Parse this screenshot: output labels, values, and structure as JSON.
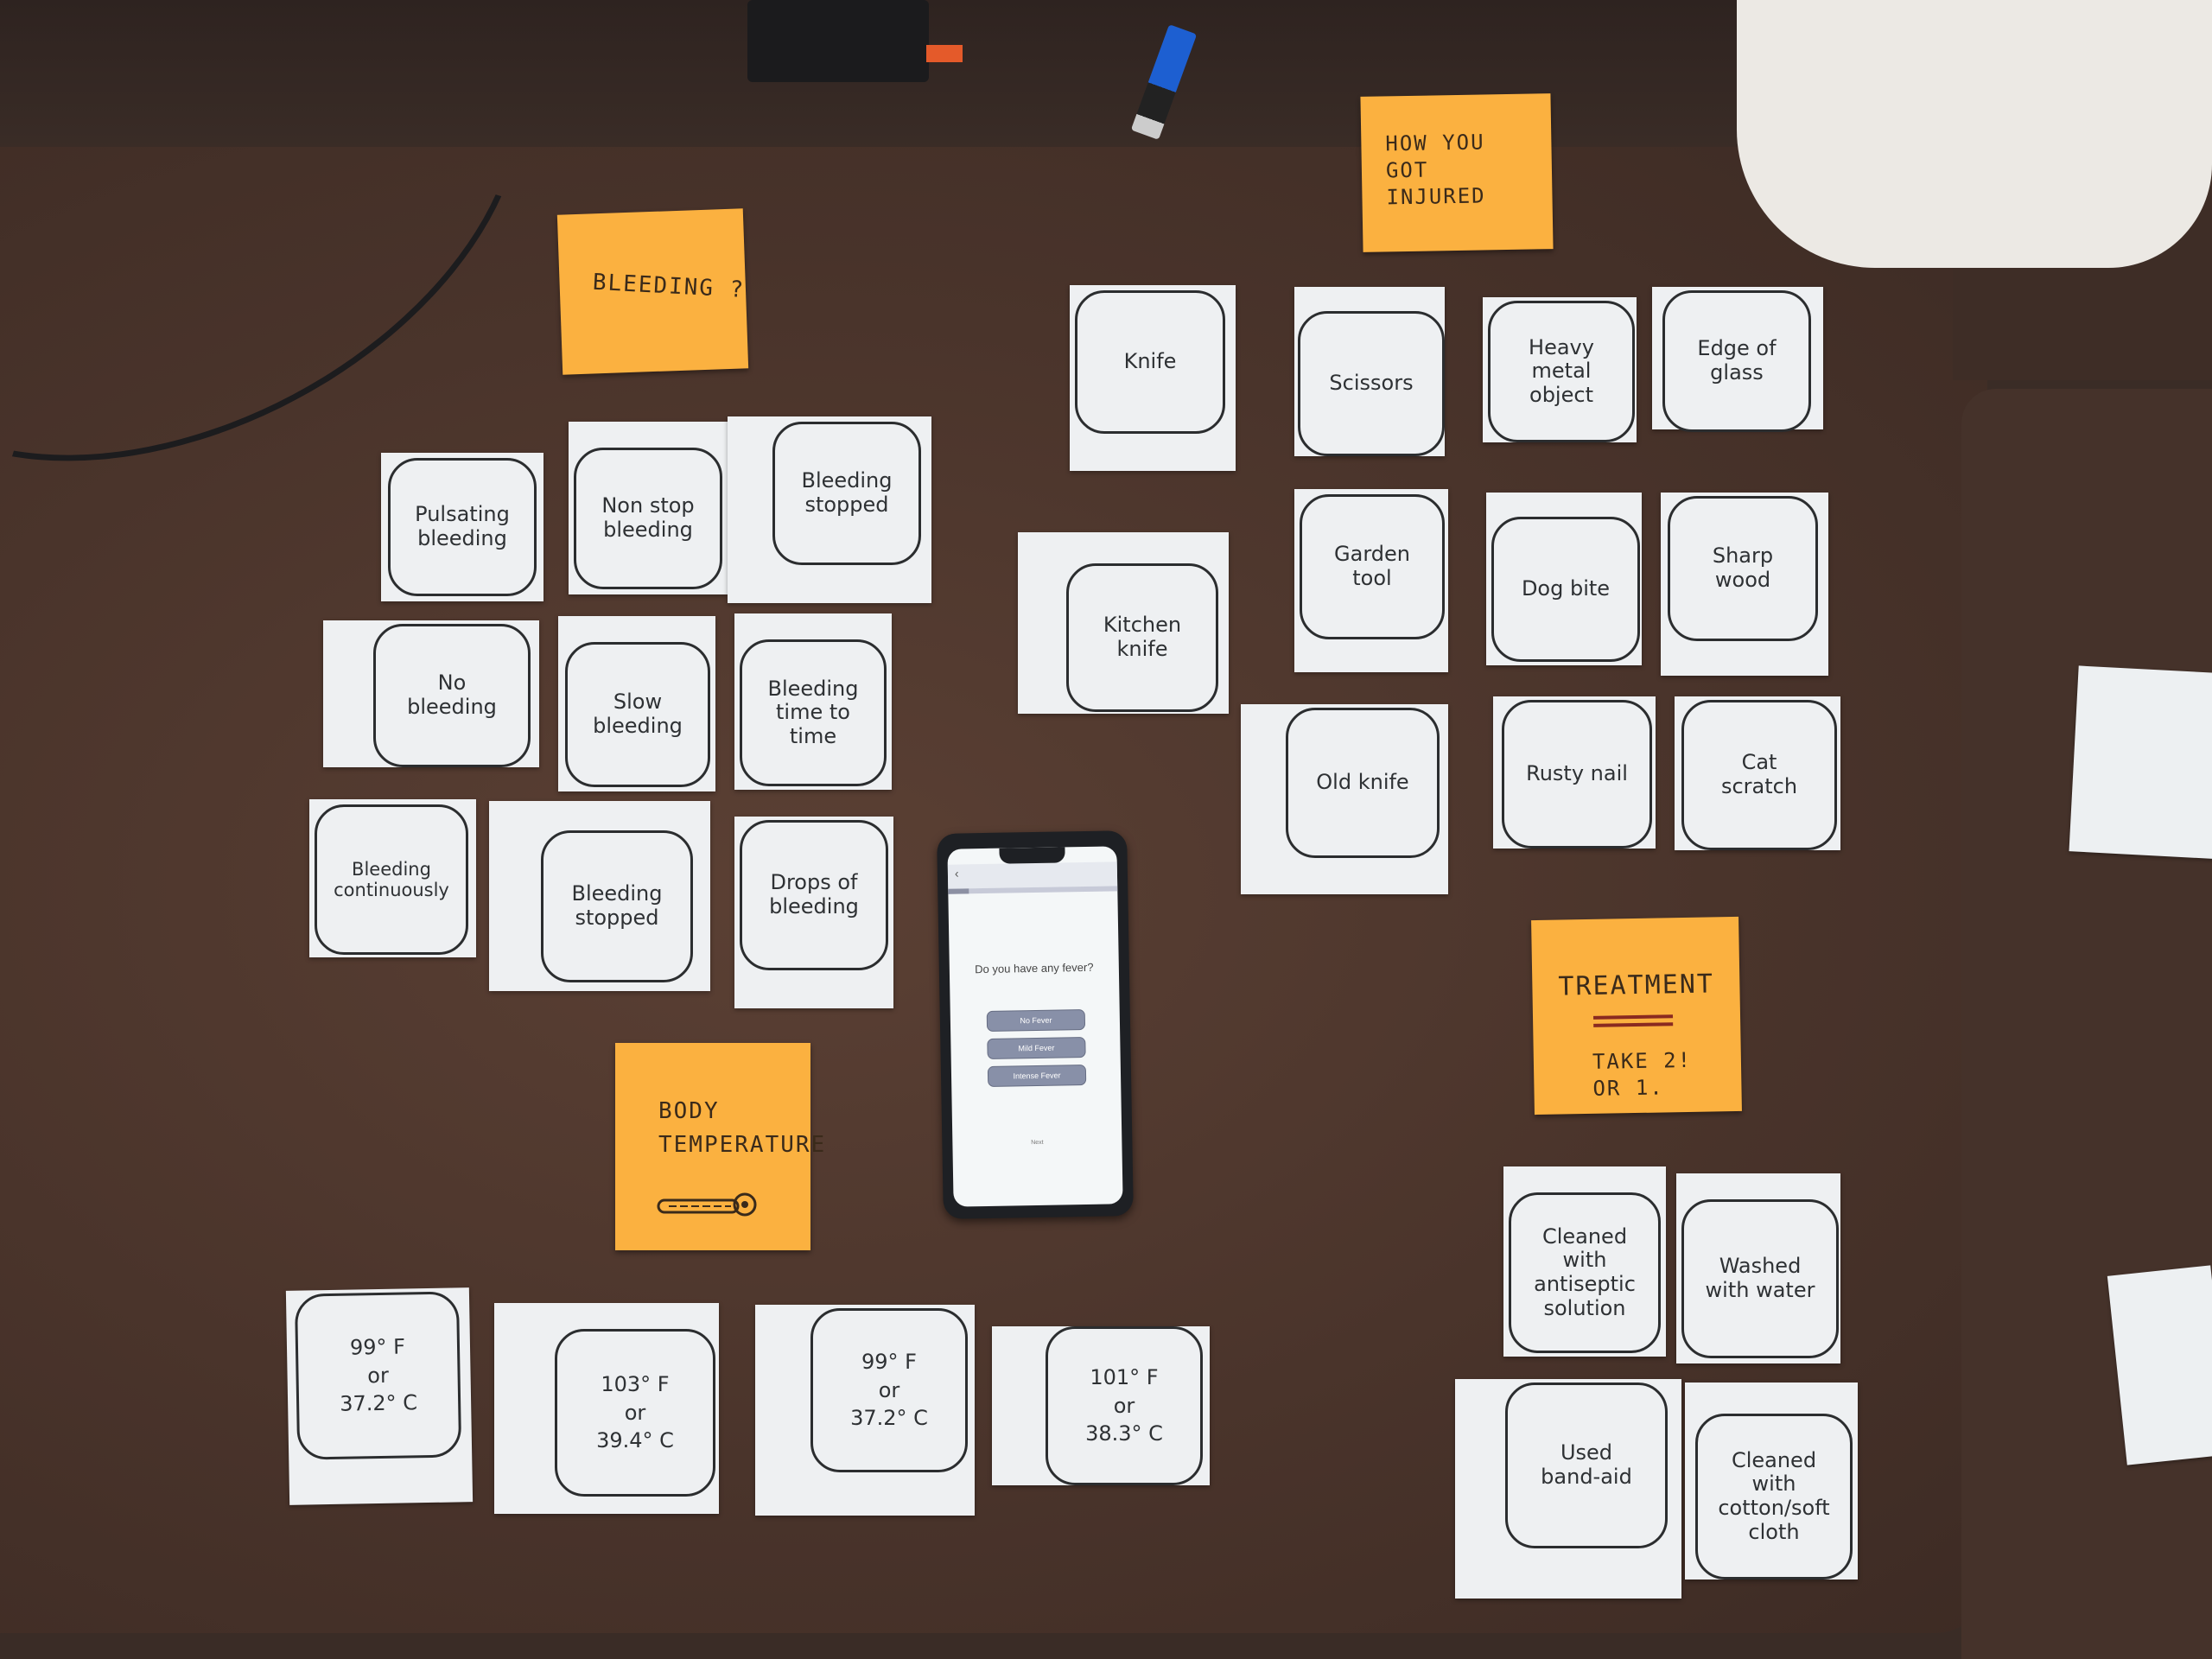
{
  "scene": {
    "description": "Card sorting session on a table with sticky-note category headers and a smartphone prototype",
    "colors": {
      "table": "#4a342b",
      "sticky": "#fbb140",
      "card": "#eef0f2",
      "button": "#8890a8"
    }
  },
  "stickies": {
    "bleeding": "BLEEDING ?",
    "how_injured": "HOW YOU\nGOT\n INJURED",
    "body_temp": "BODY\nTEMPERATURE",
    "treatment_title": "TREATMENT",
    "treatment_sub": "TAKE 2!\nOR 1."
  },
  "cards": {
    "bleeding": [
      "Pulsating\nbleeding",
      "Non stop\nbleeding",
      "Bleeding\nstopped",
      "No\nbleeding",
      "Slow\nbleeding",
      "Bleeding\ntime to\ntime",
      "Bleeding\ncontinuously",
      "Bleeding\nstopped",
      "Drops of\nbleeding"
    ],
    "injury": [
      "Knife",
      "Scissors",
      "Heavy\nmetal\nobject",
      "Edge of\nglass",
      "Kitchen\nknife",
      "Garden\ntool",
      "Dog bite",
      "Sharp\nwood",
      "Old knife",
      "Rusty nail",
      "Cat\nscratch"
    ],
    "temperature": [
      "99° F\nor\n37.2° C",
      "103° F\nor\n39.4° C",
      "99° F\nor\n37.2° C",
      "101° F\nor\n38.3° C"
    ],
    "treatment": [
      "Cleaned\nwith\nantiseptic\nsolution",
      "Washed\nwith water",
      "Used\nband-aid",
      "Cleaned\nwith\ncotton/soft\ncloth"
    ]
  },
  "phone": {
    "back_icon": "‹",
    "progress": 0.12,
    "question": "Do you have any fever?",
    "options": [
      "No Fever",
      "Mild Fever",
      "Intense Fever"
    ],
    "next_label": "Next"
  }
}
